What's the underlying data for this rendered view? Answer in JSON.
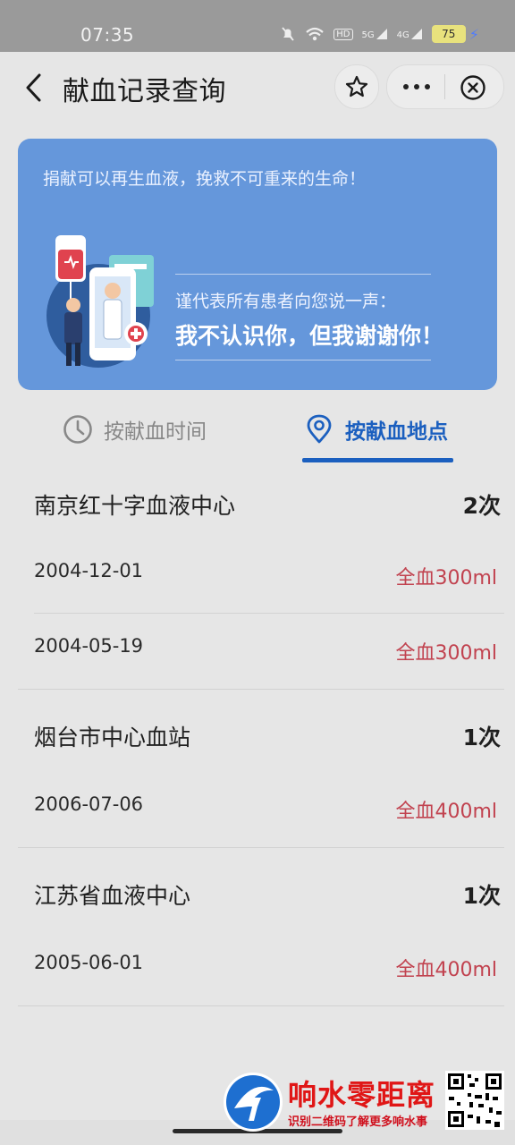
{
  "status_bar": {
    "time": "07:35",
    "battery": "75",
    "hd": "HD",
    "sig1": "5G",
    "sig2": "4G"
  },
  "nav": {
    "title": "献血记录查询"
  },
  "banner": {
    "slogan": "捐献可以再生血液，挽救不可重来的生命！",
    "sub": "谨代表所有患者向您说一声：",
    "main": "我不认识你，但我谢谢你！"
  },
  "tabs": [
    {
      "label": "按献血时间",
      "active": false,
      "icon": "clock-icon"
    },
    {
      "label": "按献血地点",
      "active": true,
      "icon": "location-pin-icon"
    }
  ],
  "groups": [
    {
      "name": "南京红十字血液中心",
      "count": "2次",
      "records": [
        {
          "date": "2004-12-01",
          "value": "全血300ml"
        },
        {
          "date": "2004-05-19",
          "value": "全血300ml"
        }
      ]
    },
    {
      "name": "烟台市中心血站",
      "count": "1次",
      "records": [
        {
          "date": "2006-07-06",
          "value": "全血400ml"
        }
      ]
    },
    {
      "name": "江苏省血液中心",
      "count": "1次",
      "records": [
        {
          "date": "2005-06-01",
          "value": "全血400ml"
        }
      ]
    }
  ],
  "watermark": {
    "title": "响水零距离",
    "sub": "识别二维码了解更多响水事"
  },
  "colors": {
    "accent": "#1b5fbf",
    "banner": "#6597db",
    "value_red": "#c1424f"
  }
}
